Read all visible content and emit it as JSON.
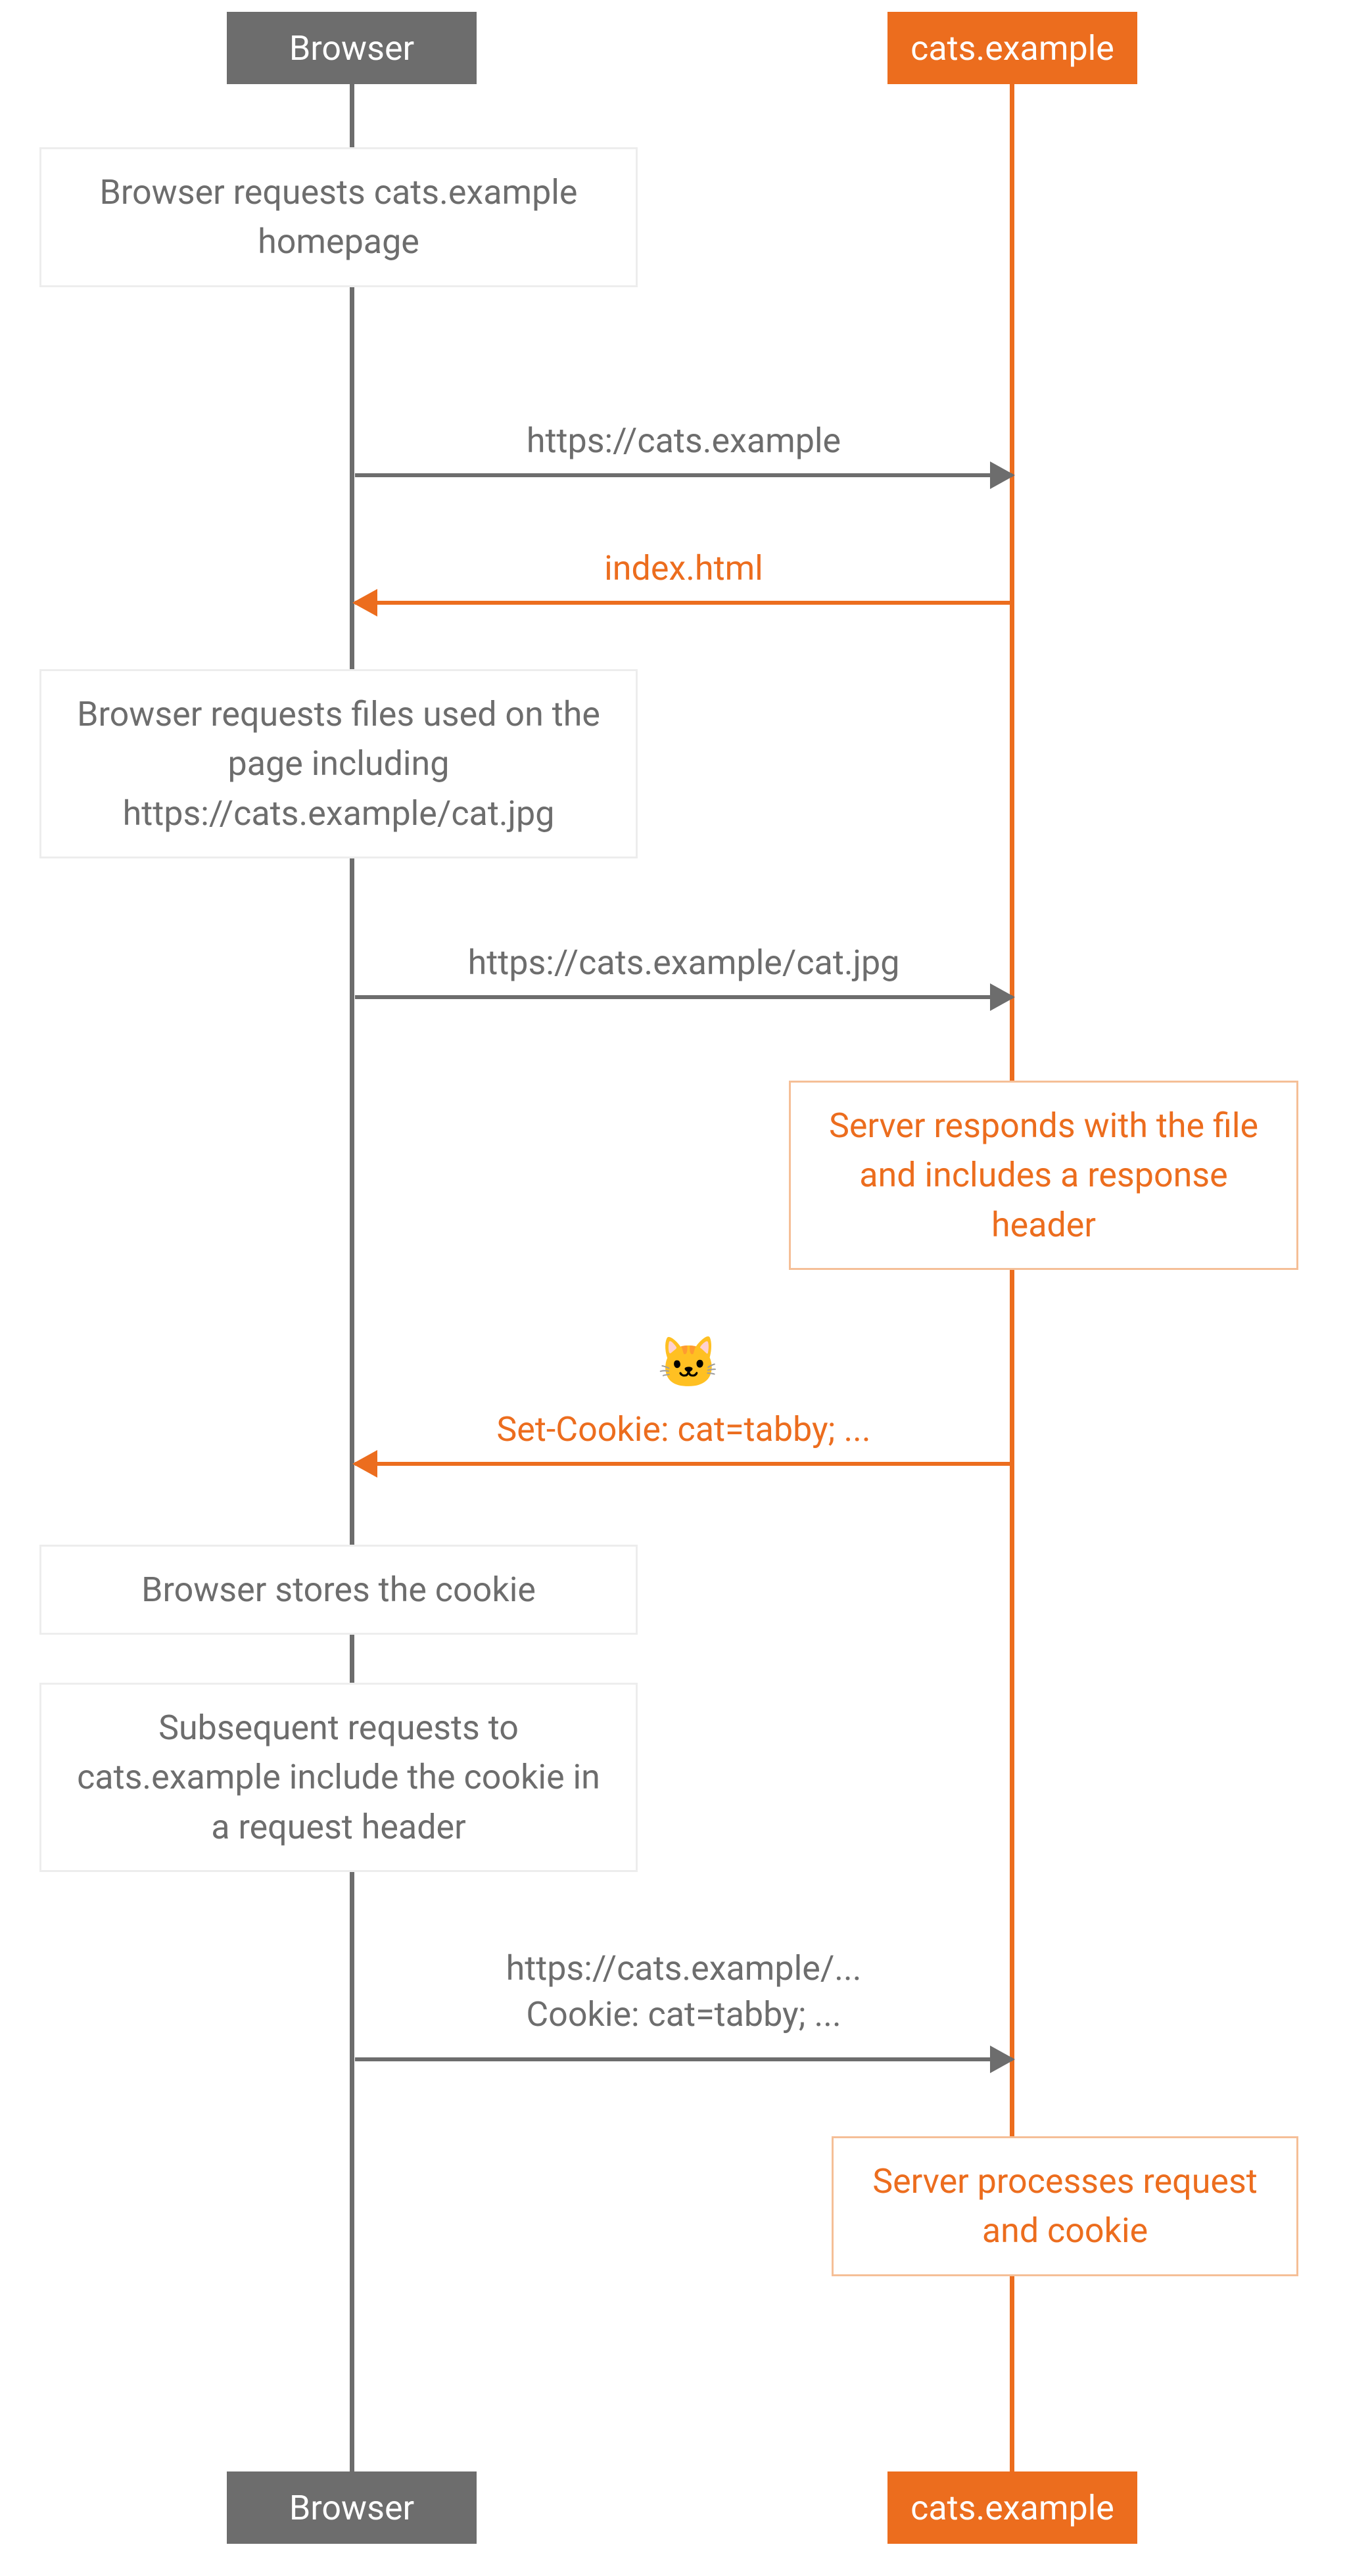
{
  "participants": {
    "browser": "Browser",
    "server": "cats.example"
  },
  "notes": {
    "n1": "Browser requests cats.example homepage",
    "n2": "Browser requests files used on the page including https://cats.example/cat.jpg",
    "n3": "Server responds with the file and includes a response header",
    "n4": "Browser stores the cookie",
    "n5": "Subsequent requests to cats.example include the cookie in a request header",
    "n6": "Server processes request and cookie"
  },
  "messages": {
    "m1": "https://cats.example",
    "m2": "index.html",
    "m3": "https://cats.example/cat.jpg",
    "m4": "Set-Cookie: cat=tabby; ...",
    "m5a": "https://cats.example/...",
    "m5b": "Cookie: cat=tabby; ..."
  },
  "emoji": {
    "cat": "🐱"
  }
}
